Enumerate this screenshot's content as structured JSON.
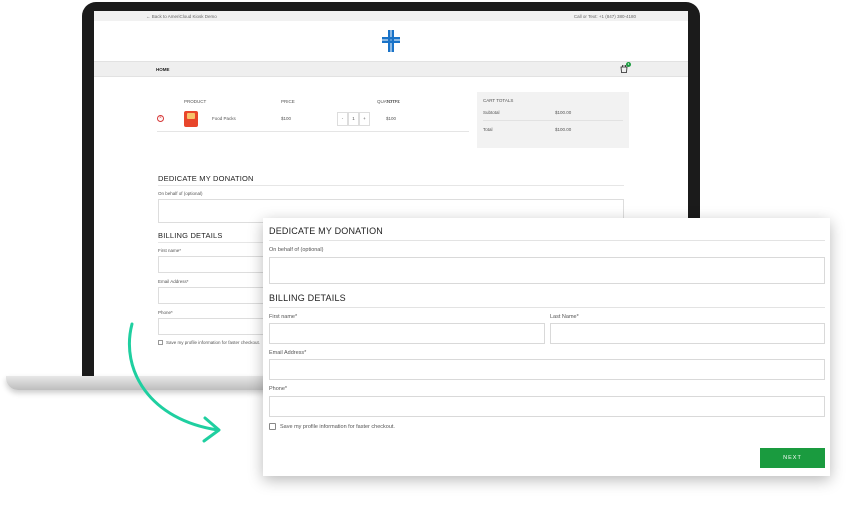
{
  "topbar": {
    "back_link": "← Back to AmeriCloud Kiosk Demo",
    "contact": "Call or Text: +1 (847) 380-4180"
  },
  "nav": {
    "home": "HOME",
    "cart_count": "1"
  },
  "cart": {
    "headers": {
      "product": "PRODUCT",
      "price": "PRICE",
      "quantity": "QUANTITY",
      "total": "TOTAL"
    },
    "items": [
      {
        "name": "Food Packs",
        "price": "$100",
        "qty": "1",
        "total": "$100",
        "minus": "-",
        "plus": "+"
      }
    ]
  },
  "cart_totals": {
    "title": "CART TOTALS",
    "subtotal_label": "Subtotal",
    "subtotal_value": "$100.00",
    "total_label": "Total",
    "total_value": "$100.00"
  },
  "form": {
    "donation_heading": "DEDICATE MY DONATION",
    "on_behalf_label": "On behalf of (optional)",
    "billing_heading": "BILLING DETAILS",
    "first_name_label": "First name*",
    "last_name_label": "Last Name*",
    "email_label": "Email Address*",
    "phone_label": "Phone*",
    "save_profile_label": "Save my profile information for faster checkout.",
    "next_button": "NEXT"
  },
  "colors": {
    "accent_green": "#1a9b3f",
    "logo_blue": "#1a73c8",
    "arrow_teal": "#1fcfa0",
    "remove_red": "#d63838"
  },
  "icons": [
    "logo-cross-icon",
    "cart-icon",
    "remove-item-icon",
    "curved-arrow-icon"
  ]
}
